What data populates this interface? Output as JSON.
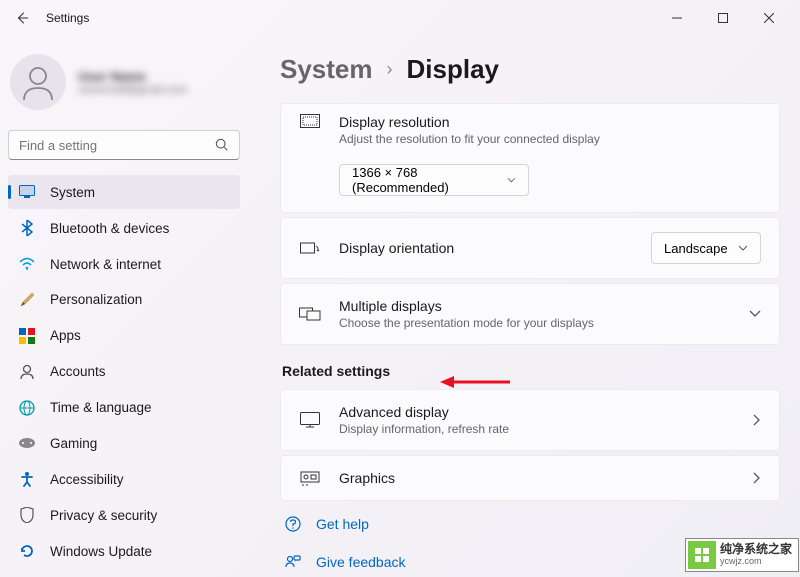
{
  "window": {
    "title": "Settings"
  },
  "profile": {
    "name": "User Name",
    "email": "useremail@gmail.com"
  },
  "search": {
    "placeholder": "Find a setting"
  },
  "nav": [
    {
      "label": "System"
    },
    {
      "label": "Bluetooth & devices"
    },
    {
      "label": "Network & internet"
    },
    {
      "label": "Personalization"
    },
    {
      "label": "Apps"
    },
    {
      "label": "Accounts"
    },
    {
      "label": "Time & language"
    },
    {
      "label": "Gaming"
    },
    {
      "label": "Accessibility"
    },
    {
      "label": "Privacy & security"
    },
    {
      "label": "Windows Update"
    }
  ],
  "breadcrumb": {
    "parent": "System",
    "current": "Display"
  },
  "cards": {
    "resolution": {
      "title": "Display resolution",
      "sub": "Adjust the resolution to fit your connected display",
      "value": "1366 × 768 (Recommended)"
    },
    "orientation": {
      "title": "Display orientation",
      "value": "Landscape"
    },
    "multiple": {
      "title": "Multiple displays",
      "sub": "Choose the presentation mode for your displays"
    },
    "advanced": {
      "title": "Advanced display",
      "sub": "Display information, refresh rate"
    },
    "graphics": {
      "title": "Graphics"
    }
  },
  "section": {
    "related": "Related settings"
  },
  "links": {
    "help": "Get help",
    "feedback": "Give feedback"
  },
  "watermark": {
    "cn": "纯净系统之家",
    "url": "ycwjz.com"
  }
}
